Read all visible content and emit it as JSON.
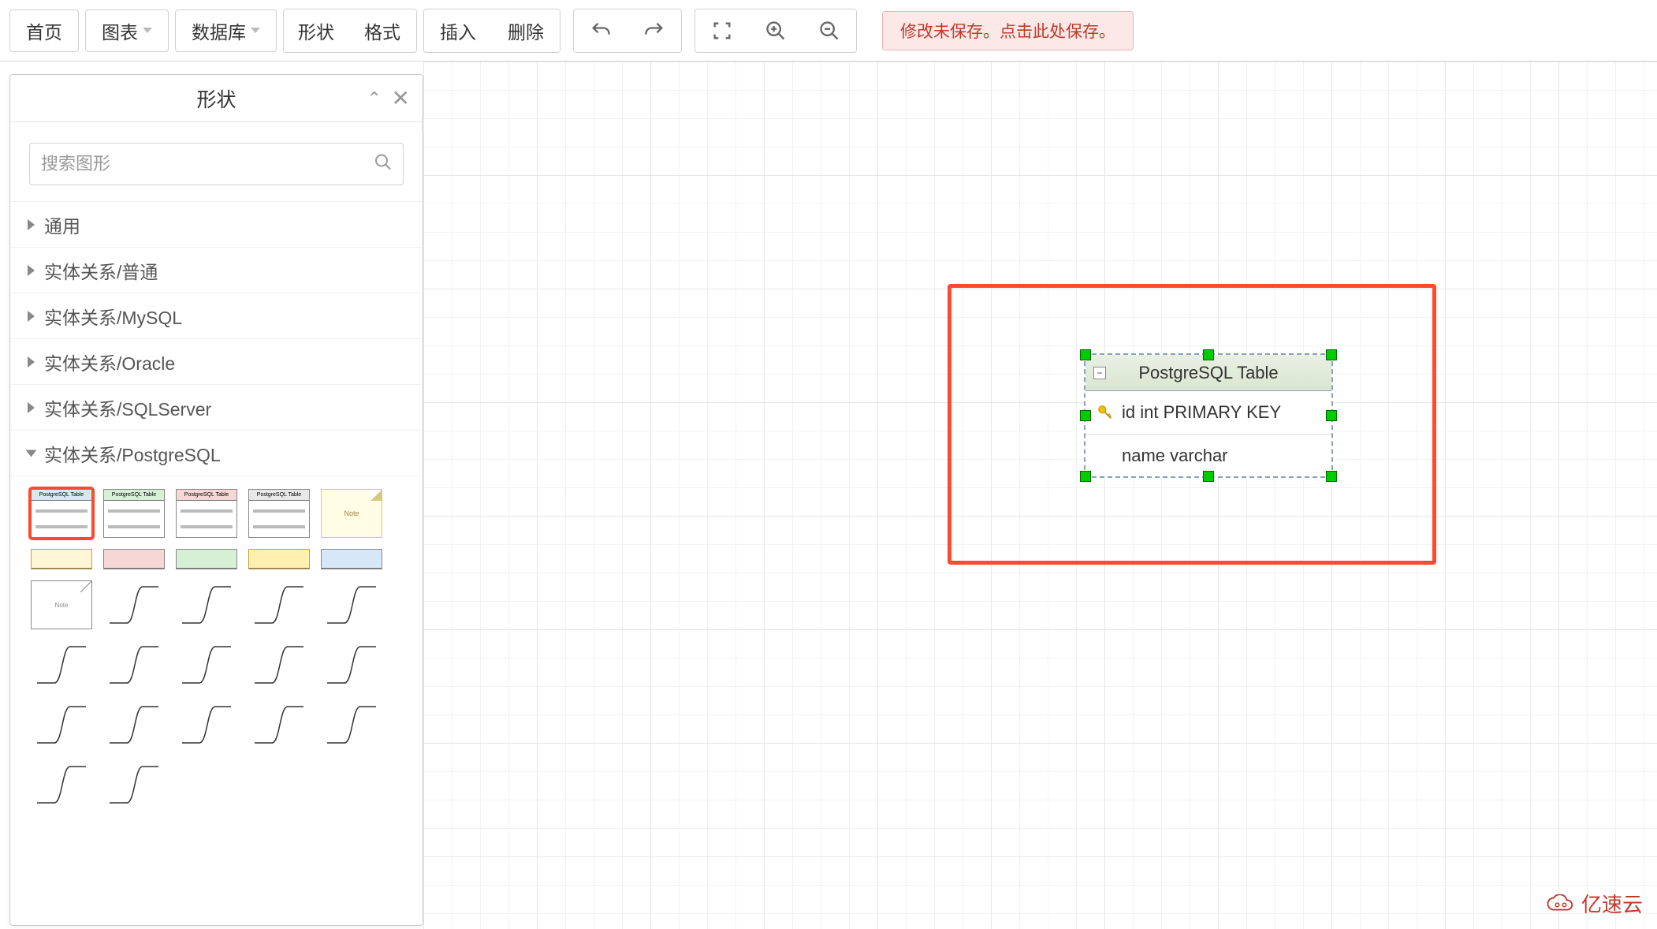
{
  "toolbar": {
    "home": "首页",
    "chart": "图表",
    "database": "数据库",
    "shape": "形状",
    "format": "格式",
    "insert": "插入",
    "delete": "删除"
  },
  "save_notice": "修改未保存。点击此处保存。",
  "side_panel": {
    "title": "形状",
    "search_placeholder": "搜索图形",
    "categories": [
      "通用",
      "实体关系/普通",
      "实体关系/MySQL",
      "实体关系/Oracle",
      "实体关系/SQLServer",
      "实体关系/PostgreSQL"
    ]
  },
  "canvas": {
    "table": {
      "title": "PostgreSQL Table",
      "rows": [
        {
          "pk": true,
          "text": "id int PRIMARY KEY"
        },
        {
          "pk": false,
          "text": "name varchar"
        }
      ]
    }
  },
  "logo": "亿速云"
}
